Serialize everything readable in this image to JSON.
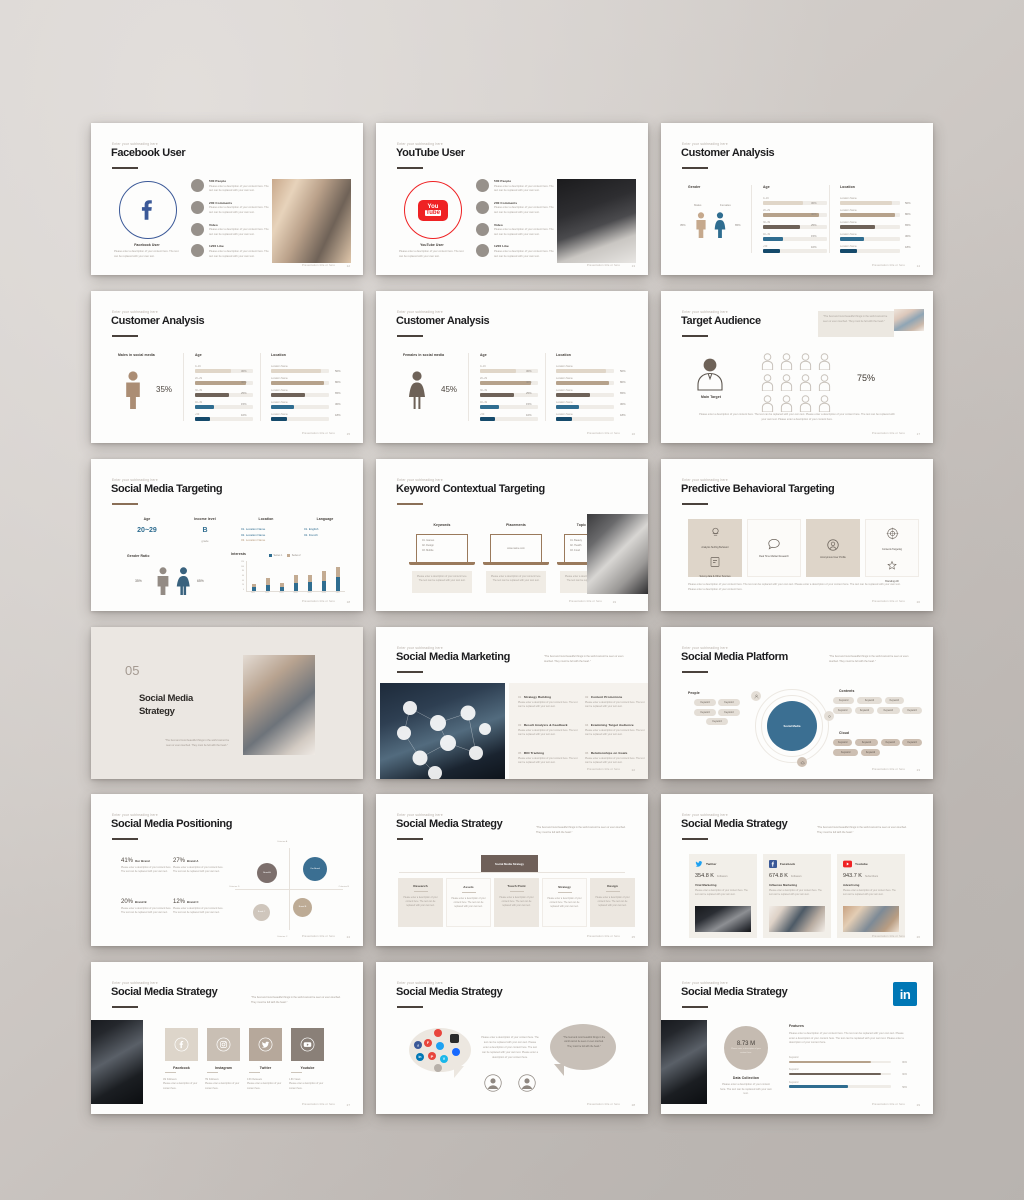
{
  "deck": {
    "footer_note": "Presentation title or here",
    "subheading": "Enter your subheading here",
    "quote": "\"The best and most beautiful things in the world cannot be seen or even touched. They must be felt with the heart.\"",
    "body_placeholder": "Please enter a description of your content here. The text can be replaced with your own text.",
    "body_placeholder_long": "Please enter a description of your content here. The text can be replaced with your own text. Please enter a description of your content here. The text can be replaced with your own text. Please enter a description of your content here."
  },
  "slides": [
    {
      "id": "facebook-user",
      "page": "12",
      "title": "Facebook User",
      "brand_label": "Facebook User",
      "brand_color": "#3b5998",
      "icon": "facebook-icon",
      "list": [
        {
          "label": "500 People"
        },
        {
          "label": "200 Comments"
        },
        {
          "label": "Video"
        },
        {
          "label": "1200 Like"
        }
      ]
    },
    {
      "id": "youtube-user",
      "page": "13",
      "title": "YouTube User",
      "brand_label": "YouTube User",
      "brand_color": "#ef2224",
      "icon": "youtube-icon",
      "list": [
        {
          "label": "500 People"
        },
        {
          "label": "200 Comments"
        },
        {
          "label": "Video"
        },
        {
          "label": "1200 Like"
        }
      ]
    },
    {
      "id": "customer-analysis-gender",
      "page": "14",
      "title": "Customer Analysis",
      "col1_label": "Gender",
      "col2_label": "Age",
      "col3_label": "Location",
      "male_label": "Males",
      "female_label": "Females",
      "male_pct": "35%",
      "female_pct": "65%",
      "age_rows": [
        {
          "label": "0~19",
          "value": "30%",
          "color": "#e0d6c8"
        },
        {
          "label": "20~29",
          "value": "40%",
          "color": "#b6a28b"
        },
        {
          "label": "30~39",
          "value": "25%",
          "color": "#6e6258"
        },
        {
          "label": "40~49",
          "value": "15%",
          "color": "#2f6d90"
        },
        {
          "label": "+50",
          "value": "10%",
          "color": "#154a6b"
        }
      ],
      "loc_rows": [
        {
          "label": "Location Name",
          "value": "50%",
          "color": "#e0d6c8"
        },
        {
          "label": "Location Name",
          "value": "80%",
          "color": "#b6a28b"
        },
        {
          "label": "Location Name",
          "value": "65%",
          "color": "#6e6258"
        },
        {
          "label": "Location Name",
          "value": "30%",
          "color": "#2f6d90"
        },
        {
          "label": "Location Name",
          "value": "18%",
          "color": "#154a6b"
        }
      ]
    },
    {
      "id": "customer-analysis-male",
      "page": "15",
      "title": "Customer Analysis",
      "col1_label": "Males in social media",
      "col2_label": "Age",
      "col3_label": "Location",
      "big_pct": "35%",
      "figure": "male-figure-icon",
      "figure_color": "#ab8d74",
      "age_rows": [
        {
          "label": "0~19",
          "value": "30%",
          "color": "#e0d6c8"
        },
        {
          "label": "20~29",
          "value": "40%",
          "color": "#b6a28b"
        },
        {
          "label": "30~39",
          "value": "25%",
          "color": "#6e6258"
        },
        {
          "label": "40~49",
          "value": "15%",
          "color": "#2f6d90"
        },
        {
          "label": "+50",
          "value": "10%",
          "color": "#154a6b"
        }
      ],
      "loc_rows": [
        {
          "label": "Location Name",
          "value": "50%",
          "color": "#e0d6c8"
        },
        {
          "label": "Location Name",
          "value": "80%",
          "color": "#b6a28b"
        },
        {
          "label": "Location Name",
          "value": "65%",
          "color": "#6e6258"
        },
        {
          "label": "Location Name",
          "value": "30%",
          "color": "#2f6d90"
        },
        {
          "label": "Location Name",
          "value": "18%",
          "color": "#154a6b"
        }
      ]
    },
    {
      "id": "customer-analysis-female",
      "page": "16",
      "title": "Customer Analysis",
      "col1_label": "Females in social media",
      "col2_label": "Age",
      "col3_label": "Location",
      "big_pct": "45%",
      "figure": "female-figure-icon",
      "figure_color": "#6e6258",
      "age_rows": [
        {
          "label": "0~19",
          "value": "30%",
          "color": "#e0d6c8"
        },
        {
          "label": "20~29",
          "value": "40%",
          "color": "#b6a28b"
        },
        {
          "label": "30~39",
          "value": "25%",
          "color": "#6e6258"
        },
        {
          "label": "40~49",
          "value": "15%",
          "color": "#2f6d90"
        },
        {
          "label": "+50",
          "value": "10%",
          "color": "#154a6b"
        }
      ],
      "loc_rows": [
        {
          "label": "Location Name",
          "value": "50%",
          "color": "#e0d6c8"
        },
        {
          "label": "Location Name",
          "value": "80%",
          "color": "#b6a28b"
        },
        {
          "label": "Location Name",
          "value": "65%",
          "color": "#6e6258"
        },
        {
          "label": "Location Name",
          "value": "30%",
          "color": "#2f6d90"
        },
        {
          "label": "Location Name",
          "value": "18%",
          "color": "#154a6b"
        }
      ]
    },
    {
      "id": "target-audience",
      "page": "17",
      "title": "Target Audience",
      "main_target_label": "Main Target",
      "big_pct": "75%",
      "people_count": 12
    },
    {
      "id": "social-media-targeting",
      "page": "18",
      "title": "Social Media Targeting",
      "fields": [
        {
          "label": "Age",
          "value": "20~29"
        },
        {
          "label": "Income level",
          "value": "B",
          "sub": "grade"
        },
        {
          "label": "Location",
          "items": [
            "01. Location Name",
            "02. Location Name",
            "03. Location Name"
          ]
        },
        {
          "label": "Language",
          "items": [
            "01. English",
            "02. French"
          ]
        }
      ],
      "gender_ratio_label": "Gender Ratio",
      "male_pct": "35%",
      "female_pct": "65%",
      "interests_label": "Interests",
      "chart_data": {
        "type": "bar",
        "stacked": true,
        "categories": [
          "2021",
          "2022",
          "2023",
          "2024",
          "2025",
          "2026",
          "2027"
        ],
        "series": [
          {
            "name": "Series 1",
            "color": "#2f6d90",
            "values": [
              18,
              26,
              17,
              34,
              38,
              42,
              56
            ]
          },
          {
            "name": "Series 2",
            "color": "#c3ab92",
            "values": [
              12,
              26,
              15,
              30,
              28,
              38,
              42
            ]
          }
        ],
        "ylim": [
          0,
          120
        ],
        "yticks": [
          0,
          20,
          40,
          60,
          80,
          100,
          120
        ],
        "title": "Interests",
        "legend_position": "top"
      }
    },
    {
      "id": "keyword-contextual-targeting",
      "page": "19",
      "title": "Keyword Contextual Targeting",
      "columns": [
        {
          "label": "Keywords",
          "items": [
            "01. Games",
            "02. Design",
            "03. Mobile"
          ]
        },
        {
          "label": "Placements",
          "items": [
            "www.name.com"
          ]
        },
        {
          "label": "Topic Targeting",
          "items": [
            "01. Beauty",
            "02. Health",
            "03. Food"
          ]
        }
      ]
    },
    {
      "id": "predictive-behavioral-targeting",
      "page": "20",
      "title": "Predictive Behavioral Targeting",
      "cards": [
        {
          "items": [
            {
              "icon": "analysis-icon",
              "label": "Analysis Surfing Behavior"
            },
            {
              "icon": "survey-icon",
              "label": "Survey data & Other Sources"
            }
          ],
          "shaded": true
        },
        {
          "items": [
            {
              "icon": "chat-icon",
              "label": "Real Time Market Research"
            }
          ],
          "shaded": false
        },
        {
          "items": [
            {
              "icon": "profile-icon",
              "label": "Anonymous User Profile"
            }
          ],
          "shaded": true
        },
        {
          "items": [
            {
              "icon": "target-icon",
              "label": "Contents Targeting"
            },
            {
              "icon": "branding-icon",
              "label": "Branding AD"
            }
          ],
          "shaded": false
        }
      ]
    },
    {
      "id": "section-social-media-strategy",
      "page": "",
      "number": "05",
      "title_line1": "Social Media",
      "title_line2": "Strategy"
    },
    {
      "id": "social-media-marketing",
      "page": "22",
      "title": "Social Media Marketing",
      "items": [
        {
          "num": "01",
          "label": "Strategy Building"
        },
        {
          "num": "02",
          "label": "Content Promotions"
        },
        {
          "num": "03",
          "label": "Result Analysis & Feedback"
        },
        {
          "num": "04",
          "label": "Examining Target Audience"
        },
        {
          "num": "05",
          "label": "ROI Tracking"
        },
        {
          "num": "06",
          "label": "Relationships on Goals"
        }
      ]
    },
    {
      "id": "social-media-platform",
      "page": "23",
      "title": "Social Media Platform",
      "center_label": "Social Media",
      "groups": [
        {
          "label": "People",
          "pills": [
            "Keyword",
            "Keyword",
            "Keyword",
            "Keyword",
            "Keyword"
          ],
          "color": "#e4ded6"
        },
        {
          "label": "Contents",
          "pills": [
            "Keyword",
            "Keyword",
            "Keyword",
            "Keyword",
            "Keyword",
            "Keyword",
            "Keyword"
          ],
          "color": "#e4ded6"
        },
        {
          "label": "Cloud",
          "pills": [
            "Keyword",
            "Keyword",
            "Keyword",
            "Keyword",
            "Keyword",
            "Keyword"
          ],
          "color": "#cdbfb2"
        }
      ]
    },
    {
      "id": "social-media-positioning",
      "page": "24",
      "title": "Social Media Positioning",
      "stats": [
        {
          "pct": "41%",
          "label": "Our Brand"
        },
        {
          "pct": "27%",
          "label": "Brand A"
        },
        {
          "pct": "20%",
          "label": "Brand B"
        },
        {
          "pct": "12%",
          "label": "Brand C"
        }
      ],
      "chart_data": {
        "type": "scatter",
        "axis_labels": {
          "top": "Criterion A",
          "right": "Criterion B",
          "bottom": "Criterion C",
          "left": "Criterion D"
        },
        "points": [
          {
            "label": "Our Brand",
            "x": 0.72,
            "y": 0.76,
            "r": 15,
            "color": "#3b6f92"
          },
          {
            "label": "Brand A",
            "x": 0.3,
            "y": 0.68,
            "r": 12.5,
            "color": "#7c6f6c"
          },
          {
            "label": "Brand B",
            "x": 0.63,
            "y": 0.32,
            "r": 11.5,
            "color": "#bdab95"
          },
          {
            "label": "Brand C",
            "x": 0.24,
            "y": 0.18,
            "r": 10,
            "color": "#cfc6bc"
          }
        ]
      }
    },
    {
      "id": "social-media-strategy-process",
      "page": "25",
      "title": "Social Media Strategy",
      "header_box": "Social Media Strategy",
      "steps": [
        {
          "label": "Research",
          "shaded": true
        },
        {
          "label": "Assets",
          "shaded": false
        },
        {
          "label": "Touch Point",
          "shaded": true
        },
        {
          "label": "Strategy",
          "shaded": false
        },
        {
          "label": "Design",
          "shaded": true
        }
      ]
    },
    {
      "id": "social-media-strategy-metrics",
      "page": "26",
      "title": "Social Media Strategy",
      "cards": [
        {
          "network": "Twitter",
          "icon": "twitter-icon",
          "color": "#1da1f2",
          "value": "354.8 K",
          "unit": "Followers",
          "caption": "Viral Marketing"
        },
        {
          "network": "Facebook",
          "icon": "facebook-icon",
          "color": "#3b5998",
          "value": "674.8 K",
          "unit": "Followers",
          "caption": "Influence Marketing"
        },
        {
          "network": "Youtube",
          "icon": "youtube-icon",
          "color": "#ef2224",
          "value": "943.7 K",
          "unit": "Subscribers",
          "caption": "Advertising"
        }
      ]
    },
    {
      "id": "social-media-strategy-networks",
      "page": "27",
      "title": "Social Media Strategy",
      "cards": [
        {
          "network": "Facebook",
          "icon": "facebook-icon",
          "color": "#ddd5ca",
          "bullets": [
            "1M Followers",
            "Please enter a description of your content here."
          ]
        },
        {
          "network": "Instagram",
          "icon": "instagram-icon",
          "color": "#c9bfb4",
          "bullets": [
            "7M Followers",
            "Please enter a description of your content here."
          ]
        },
        {
          "network": "Twitter",
          "icon": "twitter-icon",
          "color": "#b6a89b",
          "bullets": [
            "0.3K Retweets",
            "Please enter a description of your content here."
          ]
        },
        {
          "network": "Youtube",
          "icon": "youtube-icon",
          "color": "#8a8078",
          "bullets": [
            "1.8K Views",
            "Please enter a description of your content here."
          ]
        }
      ]
    },
    {
      "id": "social-media-strategy-bubbles",
      "page": "28",
      "title": "Social Media Strategy",
      "bubble_icons": [
        "facebook-icon",
        "flickr-icon",
        "dribbble-icon",
        "instagram-icon",
        "twitter-icon",
        "linkedin-icon",
        "pinterest-icon",
        "vimeo-icon",
        "behance-icon",
        "youtube-icon"
      ]
    },
    {
      "id": "social-media-strategy-linkedin",
      "page": "29",
      "title": "Social Media Strategy",
      "brand_icon": "linkedin-icon",
      "brand_color": "#0077b5",
      "big_value": "8.73 M",
      "big_sub": "Please enter a description of your content here.",
      "circle_caption": "Data Collection",
      "features_label": "Features",
      "bars": [
        {
          "label": "Keyword",
          "value": "80%",
          "color": "#b6a28b"
        },
        {
          "label": "Keyword",
          "value": "90%",
          "color": "#6e6258"
        },
        {
          "label": "Keyword",
          "value": "58%",
          "color": "#2f6d90"
        }
      ]
    }
  ]
}
